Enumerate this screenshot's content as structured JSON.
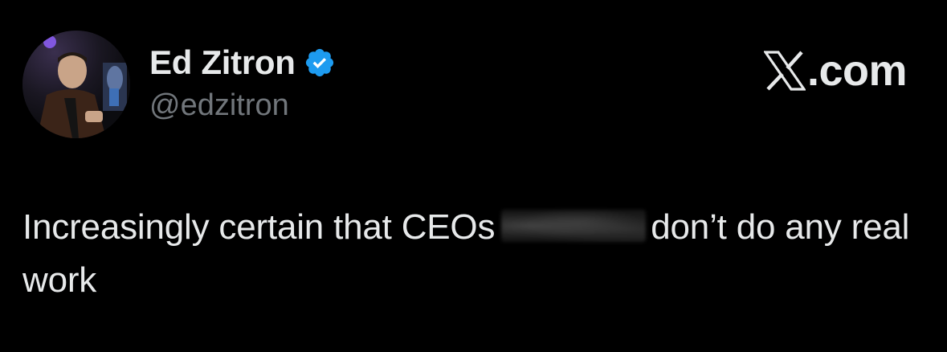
{
  "author": {
    "display_name": "Ed Zitron",
    "handle": "@edzitron",
    "verified": true
  },
  "brand": {
    "suffix": ".com",
    "icon": "x-logo-icon"
  },
  "tweet": {
    "text_before": "Increasingly certain that CEOs",
    "text_after": "don’t do any real work"
  },
  "colors": {
    "background": "#000000",
    "primary_text": "#e7e9ea",
    "secondary_text": "#71767b",
    "verified_badge": "#1d9bf0"
  }
}
